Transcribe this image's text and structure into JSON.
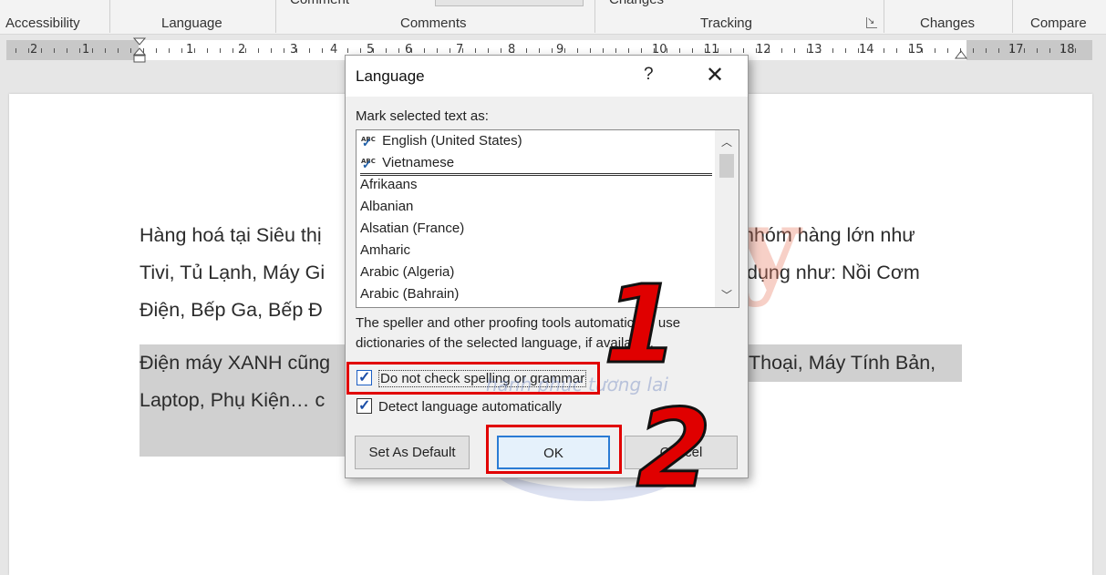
{
  "ribbon": {
    "groups": [
      "Accessibility",
      "Language",
      "Comments",
      "Tracking",
      "Changes",
      "Compare"
    ],
    "cut_labels": [
      "Comment",
      "Changes"
    ],
    "launcher": "↘"
  },
  "ruler": {
    "numbers": [
      "2",
      "1",
      "1",
      "2",
      "3",
      "4",
      "5",
      "6",
      "7",
      "8",
      "9",
      "10",
      "11",
      "12",
      "13",
      "14",
      "15",
      "17",
      "18"
    ]
  },
  "document": {
    "p1": [
      "Hàng hoá tại Siêu thị",
      "nhóm hàng lớn như",
      "Tivi, Tủ Lạnh, Máy Gi",
      "dụng như: Nồi Cơm",
      "Điện, Bếp Ga, Bếp Đ"
    ],
    "p2": [
      "Điện máy XANH cũng",
      "Thoại, Máy Tính Bản,",
      "Laptop, Phụ Kiện… c"
    ]
  },
  "watermark": {
    "brand": "Happy",
    "tagline": "hạnh phúc tương lai"
  },
  "dialog": {
    "title": "Language",
    "help": "?",
    "close": "✕",
    "mark_label": "Mark selected text as:",
    "languages": [
      "English (United States)",
      "Vietnamese",
      "Afrikaans",
      "Albanian",
      "Alsatian (France)",
      "Amharic",
      "Arabic (Algeria)",
      "Arabic (Bahrain)"
    ],
    "spell_icon_text": "ABC",
    "info_text": "The speller and other proofing tools automatically use dictionaries of the selected language, if available.",
    "checkbox_no_check": "Do not check spelling or grammar",
    "checkbox_detect": "Detect language automatically",
    "btn_default": "Set As Default",
    "btn_ok": "OK",
    "btn_cancel": "Cancel"
  },
  "annotations": {
    "step1": "1",
    "step2": "2",
    "color": "#e10000"
  }
}
